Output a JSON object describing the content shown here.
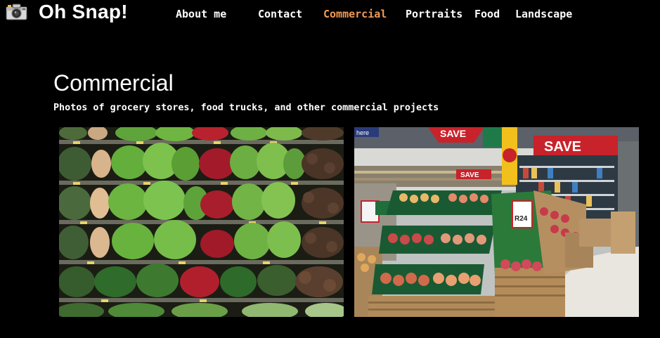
{
  "header": {
    "brand_title": "Oh Snap!",
    "logo_icon": "camera-icon"
  },
  "nav": {
    "items": [
      {
        "label": "About me",
        "active": false
      },
      {
        "label": "Contact",
        "active": false
      },
      {
        "label": "Commercial",
        "active": true
      },
      {
        "label": "Portraits",
        "active": false
      },
      {
        "label": "Food",
        "active": false
      },
      {
        "label": "Landscape",
        "active": false
      }
    ],
    "active_color": "#f29a55",
    "text_color": "#ffffff"
  },
  "main": {
    "title": "Commercial",
    "subtitle": "Photos of grocery stores, food trucks, and other commercial projects"
  },
  "gallery": {
    "photos": [
      {
        "subject": "produce shelves with lettuce, radishes and potatoes"
      },
      {
        "subject": "supermarket aisle with fruit crates",
        "signs": {
          "save_banner": "SAVE",
          "save_banner_2": "SAVE",
          "here": "here",
          "price_sign": "R24",
          "small_sign": "SAVE"
        }
      }
    ]
  },
  "colors": {
    "background": "#000000",
    "accent": "#f29a55",
    "text": "#ffffff"
  }
}
